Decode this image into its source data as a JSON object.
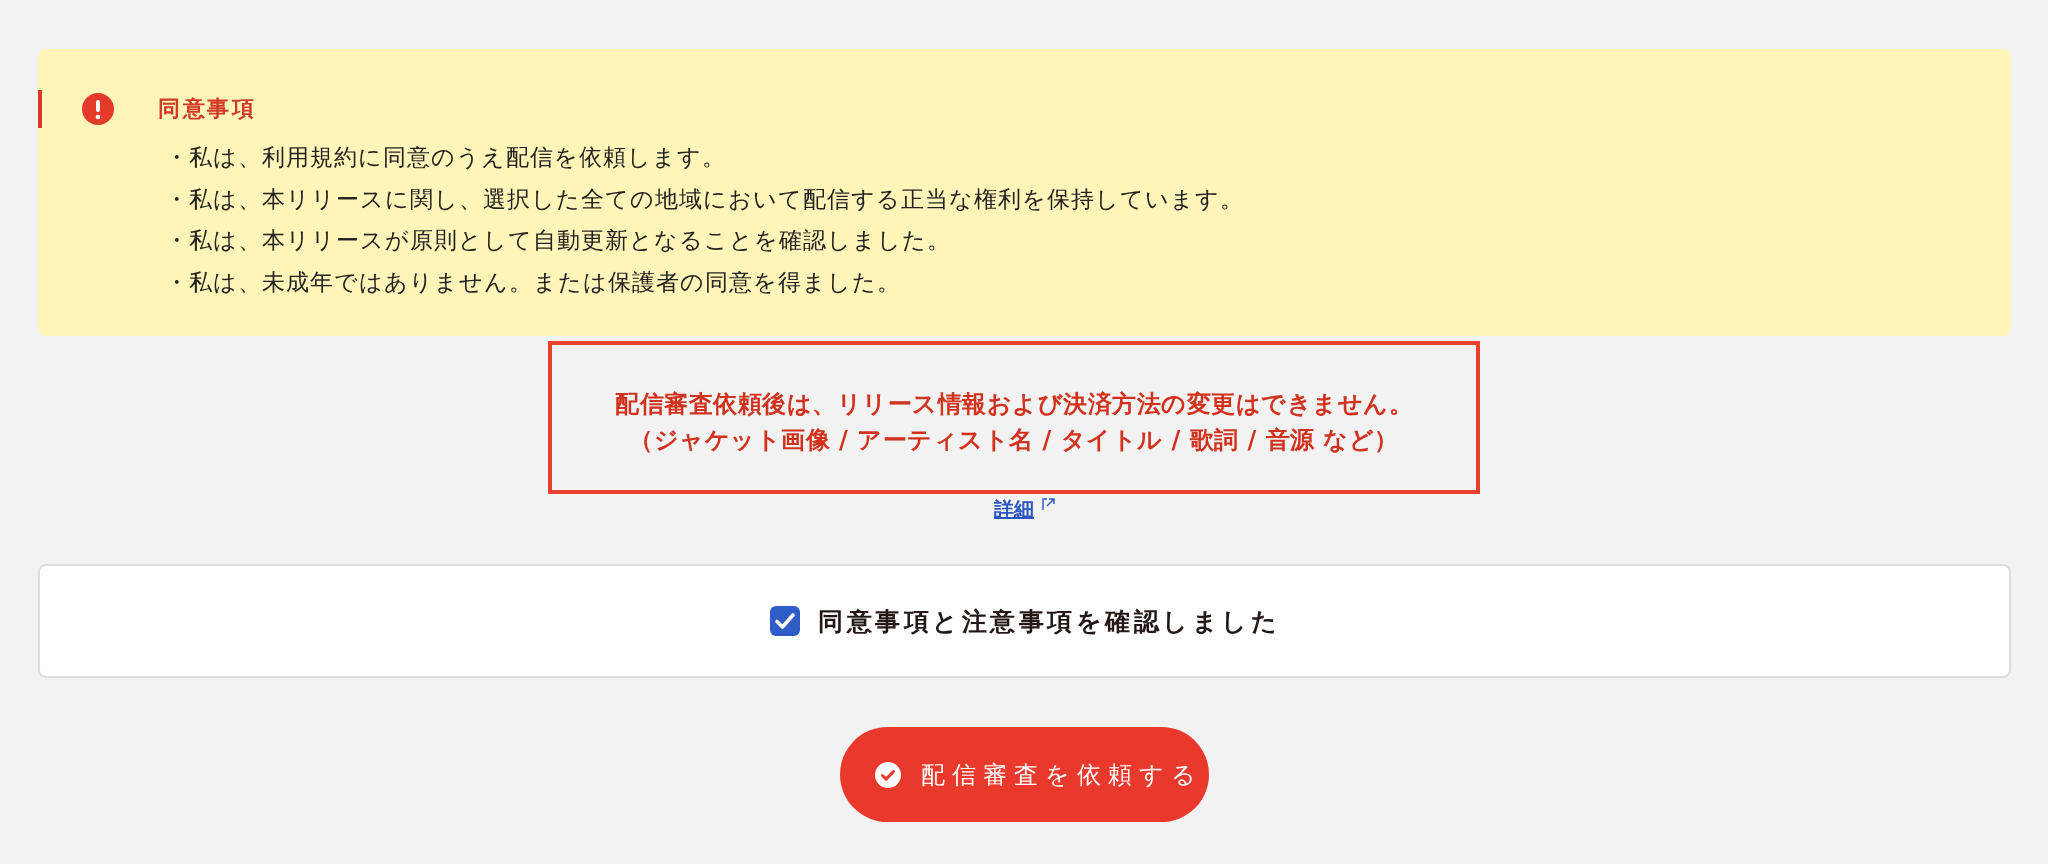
{
  "agreement": {
    "title": "同意事項",
    "items": [
      "・私は、利用規約に同意のうえ配信を依頼します。",
      "・私は、本リリースに関し、選択した全ての地域において配信する正当な権利を保持しています。",
      "・私は、本リリースが原則として自動更新となることを確認しました。",
      "・私は、未成年ではありません。または保護者の同意を得ました。"
    ]
  },
  "notice": {
    "lines": [
      "配信審査依頼後は、リリース情報および決済方法の変更はできません。",
      "（ジャケット画像 / アーティスト名 / タイトル / 歌詞 / 音源 など）"
    ],
    "link": "詳細"
  },
  "confirmation": {
    "label": "同意事項と注意事項を確認しました",
    "checked": true
  },
  "submit_button": {
    "label": "配信審査を依頼する"
  }
}
